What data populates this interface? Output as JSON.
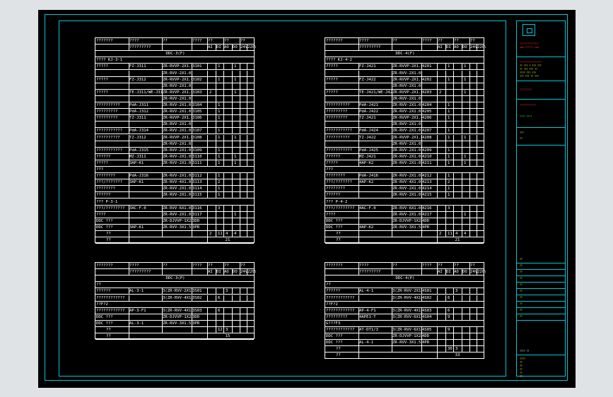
{
  "panels": [
    {
      "id": "ddc3f",
      "hdr": [
        "???????",
        "????",
        "??",
        "????",
        "??",
        "??",
        "??"
      ],
      "sub": [
        "?????????",
        "AI",
        "DI",
        "AO",
        "DO",
        "24V",
        "220V"
      ],
      "title": "DDC-3(F)",
      "rows": [
        {
          "t": "sec",
          "a": "???? KJ-3-1"
        },
        {
          "t": "d",
          "a": "?????",
          "b": "FZ-J311",
          "c": "ZR-RVVP-2X1.0",
          "d": "3101",
          "e": "",
          "f": "1",
          "g": "",
          "h": "1"
        },
        {
          "t": "c",
          "c": "ZR-RVV-2X1.0"
        },
        {
          "t": "d",
          "a": "?????",
          "b": "FZ-J312",
          "c": "ZR-RVVP-2X1.0",
          "d": "3102",
          "e": "",
          "f": "1",
          "g": "",
          "h": "1"
        },
        {
          "t": "c",
          "c": "ZR-RVV-2X1.0"
        },
        {
          "t": "d",
          "a": "?????",
          "b": "TE-J311/WE-J311",
          "c": "ZR-RVVP-2X1.0",
          "d": "3103",
          "e": "2",
          "f": "",
          "g": "",
          "h": "1"
        },
        {
          "t": "c",
          "c": "ZR-RVV-2X1.0"
        },
        {
          "t": "d",
          "a": "??????????",
          "b": "PdA-J311",
          "c": "ZR-RVV-2X1.0",
          "d": "3104",
          "e": "",
          "f": "1"
        },
        {
          "t": "d",
          "a": "?????????",
          "b": "PdA-J312",
          "c": "ZR-RVV-2X1.0",
          "d": "3105",
          "e": "",
          "f": "1"
        },
        {
          "t": "d",
          "a": "?????????",
          "b": "TZ-J311",
          "c": "ZR-RVVP-2X1.0",
          "d": "3106",
          "e": "",
          "f": "1"
        },
        {
          "t": "c",
          "c": "ZR-RVV-2X1.0"
        },
        {
          "t": "d",
          "a": "???????????",
          "b": "PdA-J314",
          "c": "ZR-RVV-2X1.0",
          "d": "3107",
          "e": "",
          "f": "1"
        },
        {
          "t": "d",
          "a": "??????????",
          "b": "TZ-J312",
          "c": "ZR-RVVP-2X1.0",
          "d": "3108",
          "e": "",
          "f": "1",
          "g": "",
          "h": "1"
        },
        {
          "t": "c",
          "c": "ZR-RVV-2X1.0"
        },
        {
          "t": "d",
          "a": "???????????",
          "b": "PdA-J315",
          "c": "ZR-RVV-2X1.0",
          "d": "3109",
          "e": "",
          "f": "1"
        },
        {
          "t": "d",
          "a": "??????",
          "b": "MZ-J311",
          "c": "ZR-RVV-2X1.0",
          "d": "3110",
          "e": "",
          "f": "1",
          "g": "",
          "h": "1"
        },
        {
          "t": "d",
          "a": "?????",
          "b": "3AP-K1",
          "c": "ZR-RVV-2X1.0",
          "d": "3111",
          "e": "",
          "f": "1",
          "g": "",
          "h": "1"
        },
        {
          "t": "sec",
          "a": "???"
        },
        {
          "t": "d",
          "a": "????????",
          "b": "PdA-J316",
          "c": "ZR-RVV-2X1.0",
          "d": "3112",
          "e": "",
          "f": "1"
        },
        {
          "t": "d",
          "a": "???/???????",
          "b": "3AP-K1",
          "c": "ZR-RVV-4X1.0",
          "d": "3113",
          "e": "",
          "f": "2"
        },
        {
          "t": "d",
          "a": "????????",
          "b": "",
          "c": "ZR-RVV-2X1.0",
          "d": "3114",
          "e": "",
          "f": "1"
        },
        {
          "t": "d",
          "a": "??????",
          "b": "",
          "c": "ZR-RVV-2X1.0",
          "d": "3115",
          "e": "",
          "f": "1"
        },
        {
          "t": "sec",
          "a": "??? P-3-1"
        },
        {
          "t": "d",
          "a": "???/????????",
          "b": "3AC-F.0",
          "c": "ZR-RVV-6X1.0",
          "d": "3116",
          "e": "",
          "f": "3"
        },
        {
          "t": "d",
          "a": "????",
          "b": "",
          "c": "ZR-RVV-2X1.0",
          "d": "3117",
          "e": "",
          "f": "",
          "g": "",
          "h": "1"
        },
        {
          "t": "d",
          "a": "DDC ???",
          "b": "",
          "c": "ZR-DJVVP-1X2X1.0",
          "d": "3DD",
          "e": "",
          "f": ""
        },
        {
          "t": "d",
          "a": "DDC ???",
          "b": "3AP-K1",
          "c": "ZR-RVV-3X1.5",
          "d": "3PR",
          "e": "",
          "f": ""
        },
        {
          "t": "tot",
          "a": "??",
          "e": "2",
          "f": "11",
          "g": "4",
          "h": "4"
        },
        {
          "t": "sum",
          "a": "??",
          "v": "21"
        }
      ]
    },
    {
      "id": "ddc4f",
      "hdr": [
        "???????",
        "????",
        "??",
        "????",
        "??",
        "??",
        "??"
      ],
      "sub": [
        "?????????",
        "AI",
        "DI",
        "AO",
        "DO",
        "24V",
        "220V"
      ],
      "title": "DDC-4(F)",
      "rows": [
        {
          "t": "sec",
          "a": "???? KJ-4-2"
        },
        {
          "t": "d",
          "a": "?????",
          "b": "FZ-J421",
          "c": "ZR-RVVP-2X1.0",
          "d": "4201",
          "e": "",
          "f": "1",
          "g": "",
          "h": "1"
        },
        {
          "t": "c",
          "c": "ZR-RVV-2X1.0"
        },
        {
          "t": "d",
          "a": "?????",
          "b": "FZ-J422",
          "c": "ZR-RVVP-2X1.0",
          "d": "4202",
          "e": "",
          "f": "1",
          "g": "",
          "h": "1"
        },
        {
          "t": "c",
          "c": "ZR-RVV-2X1.0"
        },
        {
          "t": "d",
          "a": "?????",
          "b": "TE-J421/WE-J421",
          "c": "ZR-RVVP-2X1.0",
          "d": "4203",
          "e": "2",
          "f": "",
          "g": "",
          "h": "1"
        },
        {
          "t": "c",
          "c": "ZR-RVV-2X1.0"
        },
        {
          "t": "d",
          "a": "??????????",
          "b": "PdA-J421",
          "c": "ZR-RVV-2X1.0",
          "d": "4204",
          "e": "",
          "f": "1"
        },
        {
          "t": "d",
          "a": "?????????",
          "b": "PdA-J422",
          "c": "ZR-RVV-2X1.0",
          "d": "4205",
          "e": "",
          "f": "1"
        },
        {
          "t": "d",
          "a": "?????????",
          "b": "TZ-J421",
          "c": "ZR-RVVP-2X1.0",
          "d": "4206",
          "e": "",
          "f": "1"
        },
        {
          "t": "c",
          "c": "ZR-RVV-2X1.0"
        },
        {
          "t": "d",
          "a": "???????????",
          "b": "PdA-J424",
          "c": "ZR-RVV-2X1.0",
          "d": "4207",
          "e": "",
          "f": "1"
        },
        {
          "t": "d",
          "a": "??????????",
          "b": "TZ-J422",
          "c": "ZR-RVVP-2X1.0",
          "d": "4208",
          "e": "",
          "f": "1",
          "g": "",
          "h": "1"
        },
        {
          "t": "c",
          "c": "ZR-RVV-2X1.0"
        },
        {
          "t": "d",
          "a": "???????????",
          "b": "PdA-J425",
          "c": "ZR-RVV-2X1.0",
          "d": "4209",
          "e": "",
          "f": "1"
        },
        {
          "t": "d",
          "a": "??????",
          "b": "MZ-J421",
          "c": "ZR-RVV-2X1.0",
          "d": "4210",
          "e": "",
          "f": "1",
          "g": "",
          "h": "1"
        },
        {
          "t": "d",
          "a": "?????",
          "b": "4AP-K2",
          "c": "ZR-RVV-2X1.0",
          "d": "4211",
          "e": "",
          "f": "1",
          "g": "",
          "h": "1"
        },
        {
          "t": "sec",
          "a": "???"
        },
        {
          "t": "d",
          "a": "????????",
          "b": "PdA-J416",
          "c": "ZR-RVV-2X1.0",
          "d": "4212",
          "e": "",
          "f": "1"
        },
        {
          "t": "d",
          "a": "???/???????",
          "b": "4AP-K2",
          "c": "ZR-RVV-4X1.0",
          "d": "4213",
          "e": "",
          "f": "2"
        },
        {
          "t": "d",
          "a": "????????",
          "b": "",
          "c": "ZR-RVV-2X1.0",
          "d": "4214",
          "e": "",
          "f": "1"
        },
        {
          "t": "d",
          "a": "??????",
          "b": "",
          "c": "ZR-RVV-2X1.0",
          "d": "4215",
          "e": "",
          "f": "1"
        },
        {
          "t": "sec",
          "a": "??? P-4-2"
        },
        {
          "t": "d",
          "a": "???/????????",
          "b": "4AC-F.0",
          "c": "ZR-RVV-6X1.0",
          "d": "4216",
          "e": "",
          "f": "3"
        },
        {
          "t": "d",
          "a": "????",
          "b": "",
          "c": "ZR-RVV-2X1.0",
          "d": "4217",
          "e": "",
          "f": "",
          "g": "",
          "h": "1"
        },
        {
          "t": "d",
          "a": "DDC ???",
          "b": "",
          "c": "ZR-DJVVP-1X2X1.0",
          "d": "4DD",
          "e": "",
          "f": ""
        },
        {
          "t": "d",
          "a": "DDC ???",
          "b": "4AP-K2",
          "c": "ZR-RVV-3X1.5",
          "d": "4PR",
          "e": "",
          "f": ""
        },
        {
          "t": "tot",
          "a": "??",
          "e": "2",
          "f": "11",
          "g": "4",
          "h": "4"
        },
        {
          "t": "sum",
          "a": "??",
          "v": "21"
        }
      ]
    },
    {
      "id": "ddc3p",
      "hdr": [
        "???????",
        "????",
        "??",
        "????",
        "??",
        "??",
        "??"
      ],
      "sub": [
        "?????????",
        "AI",
        "DI",
        "AO",
        "DO",
        "24V",
        "220V"
      ],
      "title": "DDC-3(P)",
      "rows": [
        {
          "t": "sec",
          "a": "??"
        },
        {
          "t": "d",
          "a": "??????",
          "b": "AL-3-1",
          "c": "3(ZR-RVV-2X1.0)",
          "d": "3S01",
          "e": "",
          "f": "",
          "g": "3"
        },
        {
          "t": "d",
          "a": "????????????",
          "b": "",
          "c": "3(ZR-RVV-4X1.0)",
          "d": "3S02",
          "e": "",
          "f": "6"
        },
        {
          "t": "sec",
          "a": "??F?2"
        },
        {
          "t": "d",
          "a": "????????????",
          "b": "AP-3-F1",
          "c": "3(ZR-RVV-4X1.0)",
          "d": "3S03",
          "e": "",
          "f": "6"
        },
        {
          "t": "d",
          "a": "DDC ???",
          "b": "",
          "c": "ZR-DJVVP-1X2X1.0",
          "d": "3DD",
          "e": "",
          "f": ""
        },
        {
          "t": "d",
          "a": "DDC ???",
          "b": "AL-3-1",
          "c": "ZR-RVV-3X1.5",
          "d": "3PR",
          "e": "",
          "f": ""
        },
        {
          "t": "tot",
          "a": "??",
          "e": "",
          "f": "12",
          "g": "3"
        },
        {
          "t": "sum",
          "a": "??",
          "v": "15"
        }
      ]
    },
    {
      "id": "ddc4p",
      "hdr": [
        "???????",
        "????",
        "??",
        "????",
        "??",
        "??",
        "??"
      ],
      "sub": [
        "?????????",
        "AI",
        "DI",
        "AO",
        "DO",
        "24V",
        "220V"
      ],
      "title": "DDC-4(P)",
      "rows": [
        {
          "t": "sec",
          "a": "??"
        },
        {
          "t": "d",
          "a": "??????",
          "b": "AL-4-1",
          "c": "3(ZR-RVV-2X1.0)",
          "d": "4S01",
          "e": "",
          "f": "",
          "g": "3"
        },
        {
          "t": "d",
          "a": "????????????",
          "b": "",
          "c": "3(ZR-RVV-4X1.0)",
          "d": "4S02",
          "e": "",
          "f": "6"
        },
        {
          "t": "sec",
          "a": "??F?2"
        },
        {
          "t": "d",
          "a": "????????????",
          "b": "AP-4-F1",
          "c": "3(ZR-RVV-4X1.0)",
          "d": "4S03",
          "e": "",
          "f": "6"
        },
        {
          "t": "d",
          "a": "?????????",
          "b": "4APE1-T",
          "c": "3(ZR-RVV-6X1.0)",
          "d": "4S04",
          "e": "",
          "f": "9"
        },
        {
          "t": "sec",
          "a": "G???F3"
        },
        {
          "t": "d",
          "a": "????????????",
          "b": "AT-DT1/3",
          "c": "3(ZR-RVV-6X1.0)",
          "d": "4S05",
          "e": "",
          "f": "9"
        },
        {
          "t": "d",
          "a": "DDC ???",
          "b": "",
          "c": "ZR-DJVVP-1X2X1.0",
          "d": "4DD",
          "e": "",
          "f": ""
        },
        {
          "t": "d",
          "a": "DDC ???",
          "b": "AL-4-1",
          "c": "ZR-RVV-3X1.5",
          "d": "4PR",
          "e": "",
          "f": ""
        },
        {
          "t": "tot",
          "a": "??",
          "e": "",
          "f": "30",
          "g": "3"
        },
        {
          "t": "sum",
          "a": "??",
          "v": "33"
        }
      ]
    }
  ],
  "titleblock": {
    "company_lines": [
      "??????????????",
      "www.??????.com"
    ],
    "info_lines": [
      "????????????????",
      "?? ??? ? ??? ???",
      "?? ??? ??? ??",
      "???? ??? ???",
      "??? ??? ?? ???"
    ],
    "project": "?????????",
    "drawing_name": "????????????",
    "sheet_code": "???? ????",
    "labels": [
      "???",
      "??",
      "??",
      "??",
      "??",
      "??",
      "??",
      "??",
      "??",
      "??",
      "??",
      "??"
    ],
    "stamp": "???? ??",
    "footer": [
      "????",
      "??",
      "??",
      "??",
      "??",
      "??"
    ]
  }
}
